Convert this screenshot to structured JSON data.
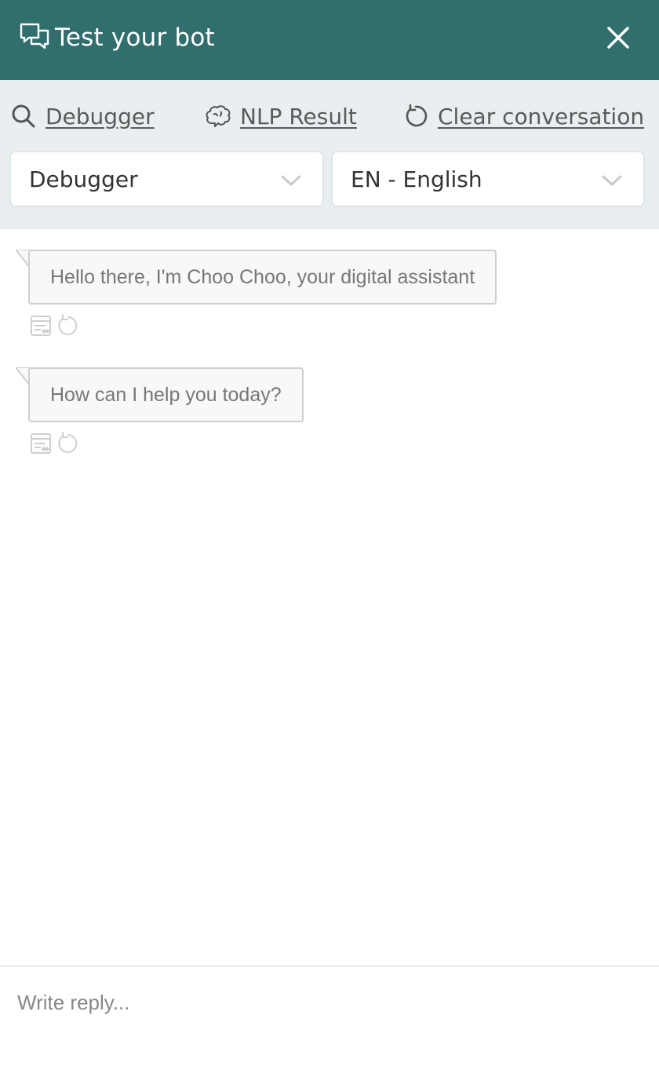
{
  "header": {
    "title": "Test your bot",
    "icon": "chat-bubbles-icon",
    "close_icon": "close-icon",
    "background": "#316f6f"
  },
  "toolbar": {
    "debugger_label": "Debugger",
    "nlp_label": "NLP Result",
    "clear_label": "Clear conversation",
    "mode_select": {
      "value": "Debugger"
    },
    "language_select": {
      "value": "EN - English"
    }
  },
  "messages": [
    {
      "text": "Hello there, I'm Choo Choo, your digital assistant"
    },
    {
      "text": "How can I help you today?"
    }
  ],
  "reply": {
    "placeholder": "Write reply..."
  }
}
